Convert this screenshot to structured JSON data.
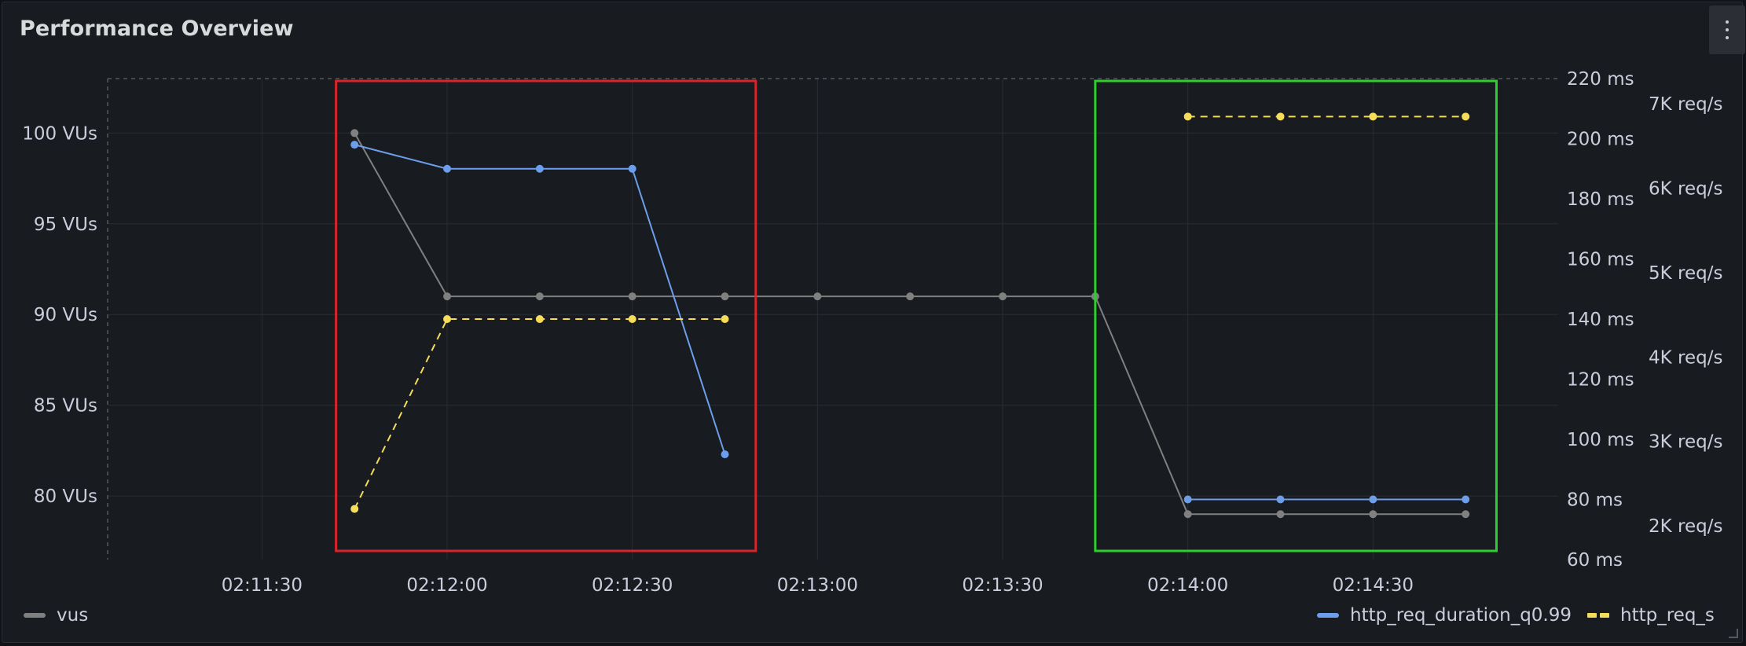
{
  "panel": {
    "title": "Performance Overview"
  },
  "colors": {
    "vus": "#808080",
    "http_req_duration_q0.99": "#6d9eeb",
    "http_req_s": "#f5dd5a",
    "highlight_red": "#d9252a",
    "highlight_green": "#2fce2f",
    "grid": "#2a2d33",
    "axis_text": "#ccccdc"
  },
  "chart_data": {
    "type": "line",
    "x_axis": {
      "ticks": [
        "02:11:30",
        "02:12:00",
        "02:12:30",
        "02:13:00",
        "02:13:30",
        "02:14:00",
        "02:14:30"
      ],
      "range": [
        "02:11:05",
        "02:15:00"
      ]
    },
    "y_axes": {
      "left": {
        "unit": "VUs",
        "range": [
          76.5,
          103
        ],
        "ticks": [
          80,
          85,
          90,
          95,
          100
        ],
        "tick_labels": [
          "80 VUs",
          "85 VUs",
          "90 VUs",
          "95 VUs",
          "100 VUs"
        ]
      },
      "right1": {
        "unit": "ms",
        "range": [
          60,
          220
        ],
        "ticks": [
          60,
          80,
          100,
          120,
          140,
          160,
          180,
          200,
          220
        ],
        "tick_labels": [
          "60 ms",
          "80 ms",
          "100 ms",
          "120 ms",
          "140 ms",
          "160 ms",
          "180 ms",
          "200 ms",
          "220 ms"
        ]
      },
      "right2": {
        "unit": "req/s",
        "range": [
          1600,
          7300
        ],
        "ticks": [
          2000,
          3000,
          4000,
          5000,
          6000,
          7000
        ],
        "tick_labels": [
          "2K req/s",
          "3K req/s",
          "4K req/s",
          "5K req/s",
          "6K req/s",
          "7K req/s"
        ]
      }
    },
    "series": [
      {
        "name": "vus",
        "axis": "left",
        "style": "solid",
        "x": [
          "02:11:45",
          "02:12:00",
          "02:12:15",
          "02:12:30",
          "02:12:45",
          "02:13:00",
          "02:13:15",
          "02:13:30",
          "02:13:45",
          "02:14:00",
          "02:14:15",
          "02:14:30",
          "02:14:45"
        ],
        "y": [
          100,
          91,
          91,
          91,
          91,
          91,
          91,
          91,
          91,
          79,
          79,
          79,
          79
        ]
      },
      {
        "name": "http_req_duration_q0.99",
        "axis": "right1",
        "style": "solid",
        "x": [
          "02:11:45",
          "02:12:00",
          "02:12:15",
          "02:12:30",
          "02:12:45",
          "02:14:00",
          "02:14:15",
          "02:14:30",
          "02:14:45"
        ],
        "y": [
          198,
          190,
          190,
          190,
          95,
          80,
          80,
          80,
          80
        ]
      },
      {
        "name": "http_req_s",
        "axis": "right2",
        "style": "dashed",
        "x": [
          "02:11:45",
          "02:12:00",
          "02:12:15",
          "02:12:30",
          "02:12:45",
          "02:14:00",
          "02:14:15",
          "02:14:30",
          "02:14:45"
        ],
        "y": [
          2200,
          4450,
          4450,
          4450,
          4450,
          6850,
          6850,
          6850,
          6850
        ]
      }
    ],
    "highlight_regions": [
      {
        "color": "red",
        "x_start": "02:11:42",
        "x_end": "02:12:50"
      },
      {
        "color": "green",
        "x_start": "02:13:45",
        "x_end": "02:14:50"
      }
    ],
    "grid": true,
    "legend": {
      "placement": "bottom",
      "left": [
        "vus"
      ],
      "right": [
        "http_req_duration_q0.99",
        "http_req_s"
      ]
    }
  }
}
